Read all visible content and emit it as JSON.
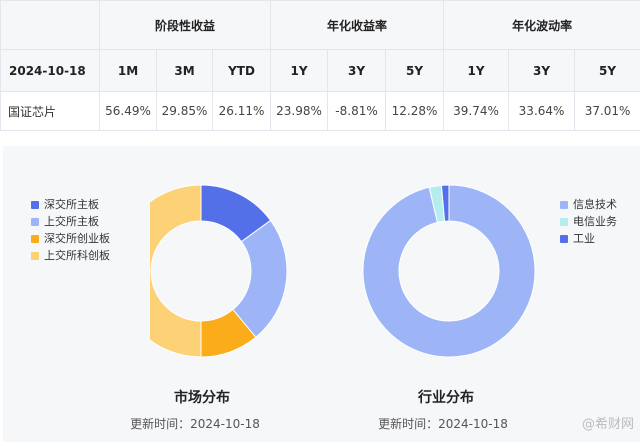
{
  "table": {
    "group_headers": [
      "阶段性收益",
      "年化收益率",
      "年化波动率"
    ],
    "date": "2024-10-18",
    "sub_headers": [
      "1M",
      "3M",
      "YTD",
      "1Y",
      "3Y",
      "5Y",
      "1Y",
      "3Y",
      "5Y"
    ],
    "row": {
      "name": "国证芯片",
      "values": [
        "56.49%",
        "29.85%",
        "26.11%",
        "23.98%",
        "-8.81%",
        "12.28%",
        "39.74%",
        "33.64%",
        "37.01%"
      ]
    }
  },
  "chart_data": [
    {
      "type": "pie",
      "title": "市场分布",
      "update": "更新时间：2024-10-18",
      "legend_position": "left",
      "slices": [
        {
          "name": "深交所主板",
          "value": 15,
          "color": "#5470e8"
        },
        {
          "name": "上交所主板",
          "value": 24,
          "color": "#9db5f7"
        },
        {
          "name": "深交所创业板",
          "value": 11,
          "color": "#fbac1a"
        },
        {
          "name": "上交所科创板",
          "value": 50,
          "color": "#fdd176"
        }
      ]
    },
    {
      "type": "pie",
      "title": "行业分布",
      "update": "更新时间：2024-10-18",
      "legend_position": "right",
      "slices": [
        {
          "name": "信息技术",
          "value": 96.3,
          "color": "#9db5f7"
        },
        {
          "name": "电信业务",
          "value": 2.3,
          "color": "#b5eded"
        },
        {
          "name": "工业",
          "value": 1.4,
          "color": "#5470e8"
        }
      ]
    }
  ],
  "watermark": "@希财网"
}
